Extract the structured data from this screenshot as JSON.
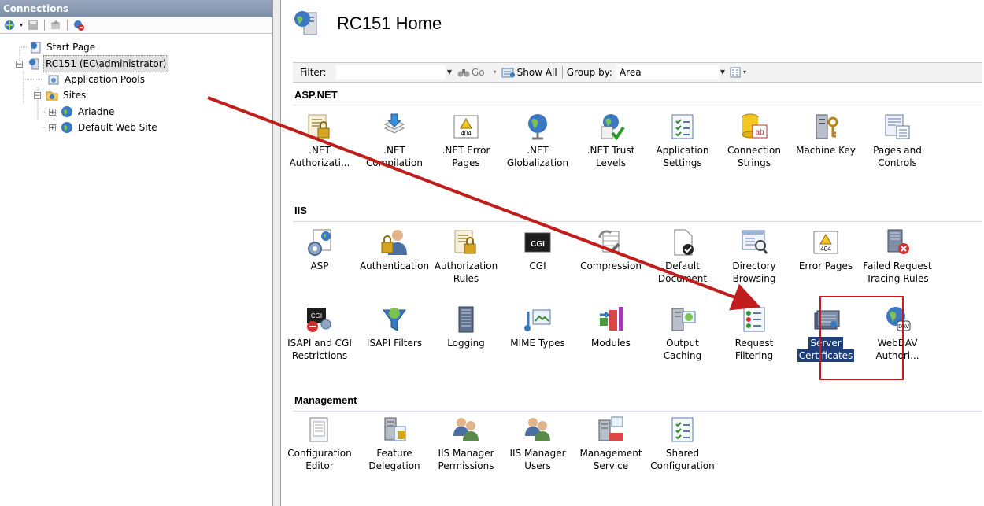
{
  "connections": {
    "title": "Connections",
    "tree": [
      {
        "label": "Start Page",
        "icon": "start-page-icon"
      },
      {
        "label": "RC151 (EC\\administrator)",
        "icon": "server-icon",
        "selected": true
      },
      {
        "label": "Application Pools",
        "icon": "app-pools-icon"
      },
      {
        "label": "Sites",
        "icon": "sites-folder-icon"
      },
      {
        "label": "Ariadne",
        "icon": "globe-icon"
      },
      {
        "label": "Default Web Site",
        "icon": "globe-icon"
      }
    ]
  },
  "main": {
    "title": "RC151 Home",
    "filter": {
      "label": "Filter:",
      "value": "",
      "go_label": "Go",
      "show_all_label": "Show All",
      "group_by_label": "Group by:",
      "group_by_value": "Area"
    },
    "groups": [
      {
        "name": "ASP.NET",
        "features": [
          {
            "line1": ".NET",
            "line2": "Authorizati...",
            "icon": "net-authorization-icon"
          },
          {
            "line1": ".NET",
            "line2": "Compilation",
            "icon": "net-compilation-icon"
          },
          {
            "line1": ".NET Error",
            "line2": "Pages",
            "icon": "net-error-pages-icon"
          },
          {
            "line1": ".NET",
            "line2": "Globalization",
            "icon": "net-globalization-icon"
          },
          {
            "line1": ".NET Trust",
            "line2": "Levels",
            "icon": "net-trust-levels-icon"
          },
          {
            "line1": "Application",
            "line2": "Settings",
            "icon": "application-settings-icon"
          },
          {
            "line1": "Connection",
            "line2": "Strings",
            "icon": "connection-strings-icon"
          },
          {
            "line1": "Machine Key",
            "line2": "",
            "icon": "machine-key-icon"
          },
          {
            "line1": "Pages and",
            "line2": "Controls",
            "icon": "pages-controls-icon"
          }
        ]
      },
      {
        "name": "IIS",
        "features": [
          {
            "line1": "ASP",
            "line2": "",
            "icon": "asp-icon"
          },
          {
            "line1": "Authentication",
            "line2": "",
            "icon": "authentication-icon"
          },
          {
            "line1": "Authorization",
            "line2": "Rules",
            "icon": "authorization-rules-icon"
          },
          {
            "line1": "CGI",
            "line2": "",
            "icon": "cgi-icon"
          },
          {
            "line1": "Compression",
            "line2": "",
            "icon": "compression-icon"
          },
          {
            "line1": "Default",
            "line2": "Document",
            "icon": "default-document-icon"
          },
          {
            "line1": "Directory",
            "line2": "Browsing",
            "icon": "directory-browsing-icon"
          },
          {
            "line1": "Error Pages",
            "line2": "",
            "icon": "error-pages-icon"
          },
          {
            "line1": "Failed Request",
            "line2": "Tracing Rules",
            "icon": "failed-request-icon"
          },
          {
            "line1": "ISAPI and CGI",
            "line2": "Restrictions",
            "icon": "isapi-cgi-icon"
          },
          {
            "line1": "ISAPI Filters",
            "line2": "",
            "icon": "isapi-filters-icon"
          },
          {
            "line1": "Logging",
            "line2": "",
            "icon": "logging-icon"
          },
          {
            "line1": "MIME Types",
            "line2": "",
            "icon": "mime-types-icon"
          },
          {
            "line1": "Modules",
            "line2": "",
            "icon": "modules-icon"
          },
          {
            "line1": "Output",
            "line2": "Caching",
            "icon": "output-caching-icon"
          },
          {
            "line1": "Request",
            "line2": "Filtering",
            "icon": "request-filtering-icon"
          },
          {
            "line1": "Server",
            "line2": "Certificates",
            "icon": "server-certificates-icon",
            "selected": true
          },
          {
            "line1": "WebDAV",
            "line2": "Authori...",
            "icon": "webdav-icon"
          }
        ]
      },
      {
        "name": "Management",
        "features": [
          {
            "line1": "Configuration",
            "line2": "Editor",
            "icon": "configuration-editor-icon"
          },
          {
            "line1": "Feature",
            "line2": "Delegation",
            "icon": "feature-delegation-icon"
          },
          {
            "line1": "IIS Manager",
            "line2": "Permissions",
            "icon": "iis-manager-permissions-icon"
          },
          {
            "line1": "IIS Manager",
            "line2": "Users",
            "icon": "iis-manager-users-icon"
          },
          {
            "line1": "Management",
            "line2": "Service",
            "icon": "management-service-icon"
          },
          {
            "line1": "Shared",
            "line2": "Configuration",
            "icon": "shared-configuration-icon"
          }
        ]
      }
    ]
  },
  "colors": {
    "arrow": "#c01d1d",
    "highlight_box": "#c01d1d",
    "selection": "#1f3f7a"
  }
}
